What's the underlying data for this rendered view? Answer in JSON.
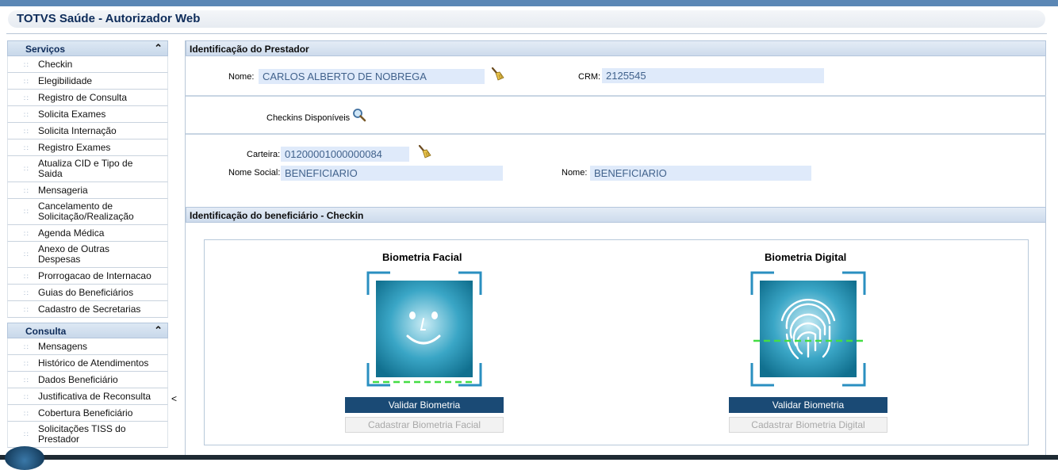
{
  "app": {
    "title": "TOTVS Saúde - Autorizador Web"
  },
  "sidebar": {
    "sections": [
      {
        "title": "Serviços",
        "items": [
          "Checkin",
          "Elegibilidade",
          "Registro de Consulta",
          "Solicita Exames",
          "Solicita Internação",
          "Registro Exames",
          "Atualiza CID e Tipo de\nSaida",
          "Mensageria",
          "Cancelamento de\nSolicitação/Realização",
          "Agenda Médica",
          "Anexo de Outras\nDespesas",
          "Prorrogacao de Internacao",
          "Guias do Beneficiários",
          "Cadastro de Secretarias"
        ]
      },
      {
        "title": "Consulta",
        "items": [
          "Mensagens",
          "Histórico de Atendimentos",
          "Dados Beneficiário",
          "Justificativa de Reconsulta",
          "Cobertura Beneficiário",
          "Solicitações TISS do\nPrestador"
        ]
      }
    ],
    "collapse_glyph": "<"
  },
  "prestador": {
    "header": "Identificação do Prestador",
    "nome_label": "Nome:",
    "nome_value": "CARLOS ALBERTO DE NOBREGA",
    "crm_label": "CRM:",
    "crm_value": "2125545"
  },
  "checkins": {
    "label": "Checkins Disponíveis"
  },
  "beneficiario": {
    "carteira_label": "Carteira:",
    "carteira_value": "01200001000000084",
    "nome_social_label": "Nome Social:",
    "nome_social_value": "BENEFICIARIO",
    "nome_label": "Nome:",
    "nome_value": "BENEFICIARIO"
  },
  "checkin_section": {
    "header": "Identificação do beneficiário - Checkin",
    "facial": {
      "title": "Biometria Facial",
      "validate_label": "Validar Biometria",
      "register_label": "Cadastrar Biometria Facial"
    },
    "digital": {
      "title": "Biometria Digital",
      "validate_label": "Validar Biometria",
      "register_label": "Cadastrar Biometria Digital"
    }
  },
  "icons": {
    "clear": "broom-icon",
    "search": "magnifier-icon",
    "face": "face-scan-icon",
    "fingerprint": "fingerprint-scan-icon"
  },
  "colors": {
    "primary_button": "#1a4a75",
    "field_bg": "#dfeafa",
    "field_text": "#41628c",
    "scan_line": "#44dd44",
    "scan_frame": "#2a8fc0"
  }
}
